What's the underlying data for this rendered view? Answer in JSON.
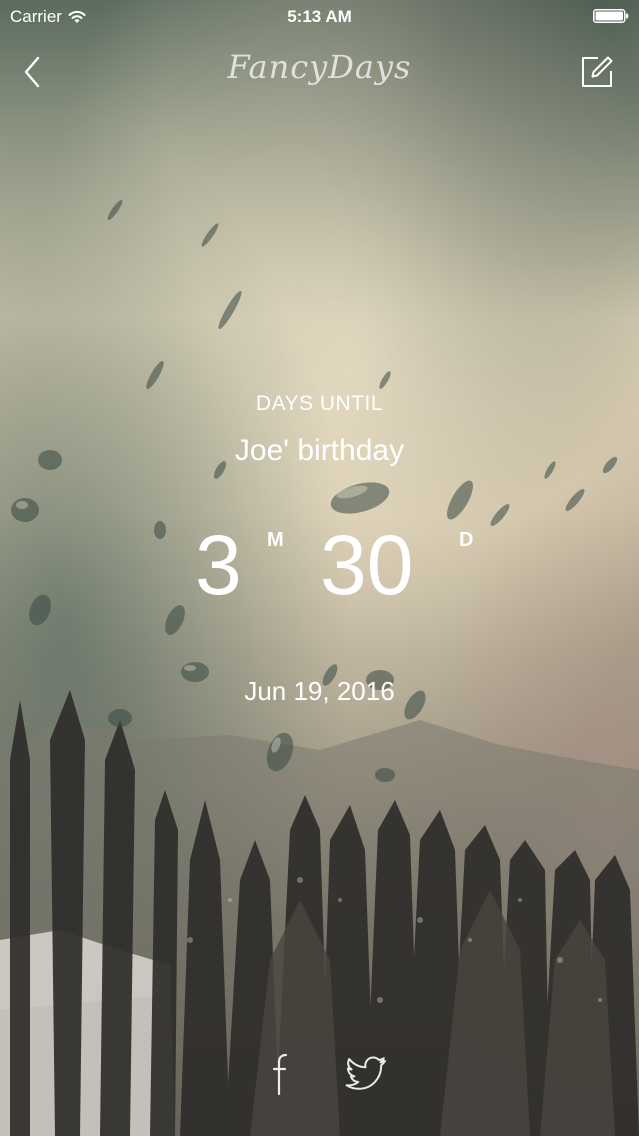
{
  "status_bar": {
    "carrier": "Carrier",
    "time": "5:13 AM",
    "icons": [
      "wifi-icon",
      "battery-icon"
    ]
  },
  "nav": {
    "title": "FancyDays",
    "back_icon": "chevron-left-icon",
    "edit_icon": "edit-icon"
  },
  "countdown": {
    "label": "DAYS UNTIL",
    "event_name": "Joe' birthday",
    "months": "3",
    "months_unit": "M",
    "days": "30",
    "days_unit": "D",
    "target_date": "Jun 19, 2016"
  },
  "share": {
    "icons": [
      "facebook-icon",
      "twitter-icon"
    ]
  },
  "colors": {
    "text": "#ffffff",
    "sky": "#d8cdb4",
    "forest": "#3a3833",
    "teal": "#566b62"
  }
}
